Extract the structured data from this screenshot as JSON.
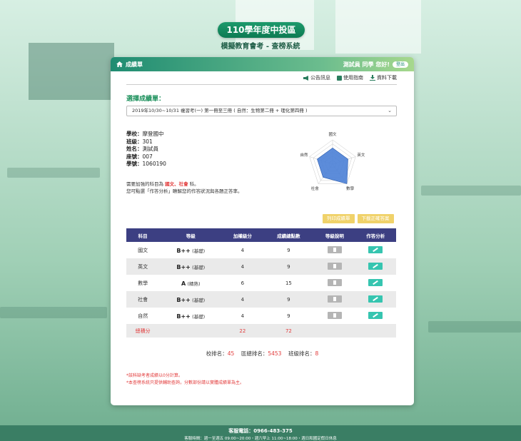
{
  "header": {
    "title": "110學年度中投區",
    "subtitle": "模擬教育會考 - 查榜系統"
  },
  "card_header": {
    "home_label": "成績單",
    "user_greeting": "測試員 同學 您好!",
    "logout_label": "登出"
  },
  "toolbar": {
    "announcement": "公告訊息",
    "guide": "使用指南",
    "download": "資料下載"
  },
  "select": {
    "label": "選擇成績單：",
    "value": "2019年10/30~10/31 複習考(一) 第一冊至三冊 ( 自然：生物第二冊 + 理化第四冊 )"
  },
  "student": {
    "school_label": "學校：",
    "school": "摩登國中",
    "class_label": "班級：",
    "class": "301",
    "name_label": "姓名：",
    "name": "測試員",
    "seat_label": "座號：",
    "seat": "007",
    "id_label": "學號：",
    "id": "1060190"
  },
  "advice": {
    "line1_prefix": "需要加強的科目為",
    "subjects": "國文、社會",
    "line1_suffix": "科。",
    "line2": "您可點選「作答分析」瞭解您的作答狀況與各題正答率。"
  },
  "radar": {
    "labels": [
      "國文",
      "英文",
      "數學",
      "社會",
      "自然"
    ],
    "values": [
      4,
      4,
      6,
      4,
      4
    ],
    "max": 6,
    "fill": "#4a7fd6"
  },
  "buttons": {
    "print": "列印成績單",
    "download_answers": "下載正確答案"
  },
  "table": {
    "headers": [
      "科目",
      "等級",
      "加權級分",
      "成績總點數",
      "等級說明",
      "作答分析"
    ],
    "rows": [
      {
        "subject": "國文",
        "grade": "B++",
        "grade_note": "(基礎)",
        "weighted": "4",
        "points": "9"
      },
      {
        "subject": "英文",
        "grade": "B++",
        "grade_note": "(基礎)",
        "weighted": "4",
        "points": "9"
      },
      {
        "subject": "數學",
        "grade": "A",
        "grade_note": "(精熟)",
        "weighted": "6",
        "points": "15"
      },
      {
        "subject": "社會",
        "grade": "B++",
        "grade_note": "(基礎)",
        "weighted": "4",
        "points": "9"
      },
      {
        "subject": "自然",
        "grade": "B++",
        "grade_note": "(基礎)",
        "weighted": "4",
        "points": "9"
      }
    ],
    "total": {
      "label": "總積分",
      "weighted": "22",
      "points": "72"
    }
  },
  "rank": {
    "school_label": "校排名：",
    "school": "45",
    "region_label": "區總排名：",
    "region": "5453",
    "class_label": "班級排名：",
    "class": "8"
  },
  "notes": {
    "line1": "*該科缺考者成績以0分計算。",
    "line2": "*本查榜系統只提供輔助查詢，分數部份請以實體成績單為主。"
  },
  "footer": {
    "phone": "客服電話：0966-483-375",
    "hours": "客服時間：週一至週五 09:00~20:00・週六早上 11:00~18:00・週日和國定假日休息"
  },
  "colors": {
    "accent": "#1a8f5a",
    "table_header": "#3c3f82",
    "alert": "#e23b3b",
    "button_yellow": "#f0d26a",
    "button_teal": "#36c5b0"
  }
}
